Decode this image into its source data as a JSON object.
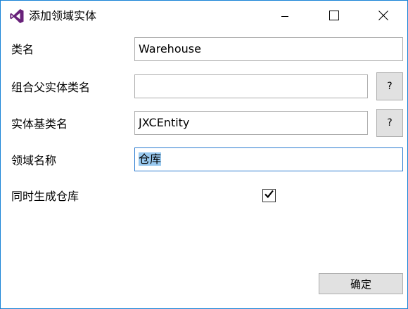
{
  "window": {
    "title": "添加领域实体",
    "accent_color": "#1883d7",
    "icon": "visual-studio-icon",
    "controls": [
      "minimize-icon",
      "maximize-icon",
      "close-icon"
    ]
  },
  "form": {
    "class_name": {
      "label": "类名",
      "value": "Warehouse"
    },
    "parent_entity": {
      "label": "组合父实体类名",
      "value": "",
      "button_label": "?"
    },
    "base_class": {
      "label": "实体基类名",
      "value": "JXCEntity",
      "button_label": "?"
    },
    "domain_name": {
      "label": "领域名称",
      "value": "仓库"
    },
    "generate_warehouse": {
      "label": "同时生成仓库",
      "checked": true
    }
  },
  "footer": {
    "ok_label": "确定"
  }
}
